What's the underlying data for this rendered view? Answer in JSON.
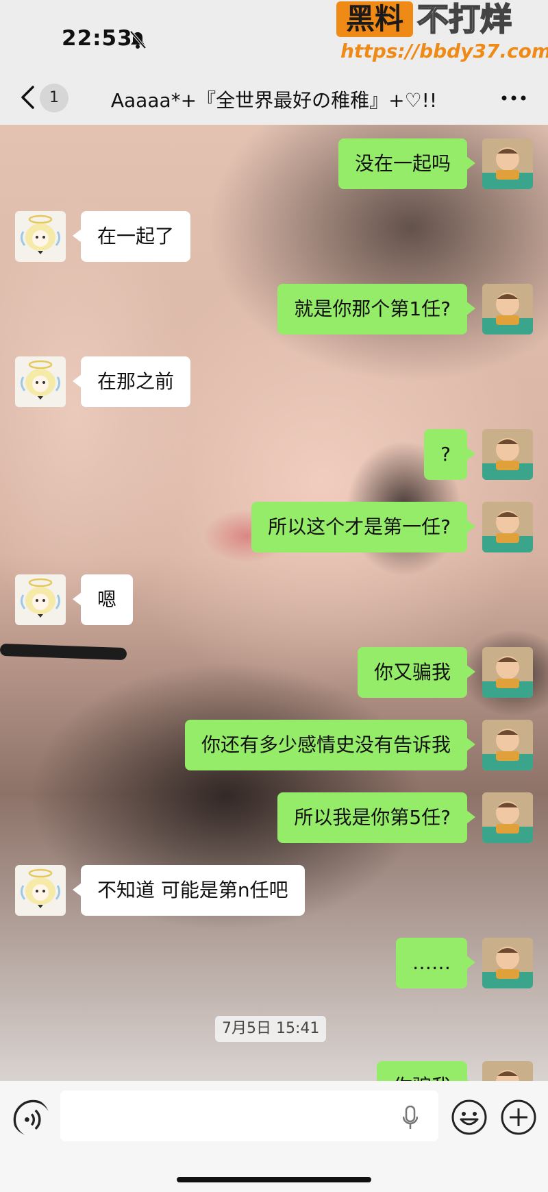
{
  "status": {
    "time": "22:53"
  },
  "watermark": {
    "badge": "黑料",
    "text": "不打烊",
    "url": "https://bbdy37.com"
  },
  "header": {
    "unread_count": "1",
    "title": "Aaaaa*+『全世界最好の稚稚』+♡!!"
  },
  "messages": [
    {
      "from": "me",
      "text": "没在一起吗"
    },
    {
      "from": "them",
      "text": "在一起了"
    },
    {
      "from": "me",
      "text": "就是你那个第1任?"
    },
    {
      "from": "them",
      "text": "在那之前"
    },
    {
      "from": "me",
      "text": "?"
    },
    {
      "from": "me",
      "text": "所以这个才是第一任?"
    },
    {
      "from": "them",
      "text": "嗯"
    },
    {
      "from": "me",
      "text": "你又骗我"
    },
    {
      "from": "me",
      "text": "你还有多少感情史没有告诉我"
    },
    {
      "from": "me",
      "text": "所以我是你第5任?"
    },
    {
      "from": "them",
      "text": "不知道 可能是第n任吧"
    },
    {
      "from": "me",
      "text": "……"
    },
    {
      "from": "me",
      "text": "你骗我"
    }
  ],
  "timestamp": "7月5日 15:41",
  "input": {
    "placeholder": ""
  },
  "colors": {
    "me_bubble": "#95ec69",
    "them_bubble": "#ffffff",
    "header_bg": "#ededed"
  }
}
